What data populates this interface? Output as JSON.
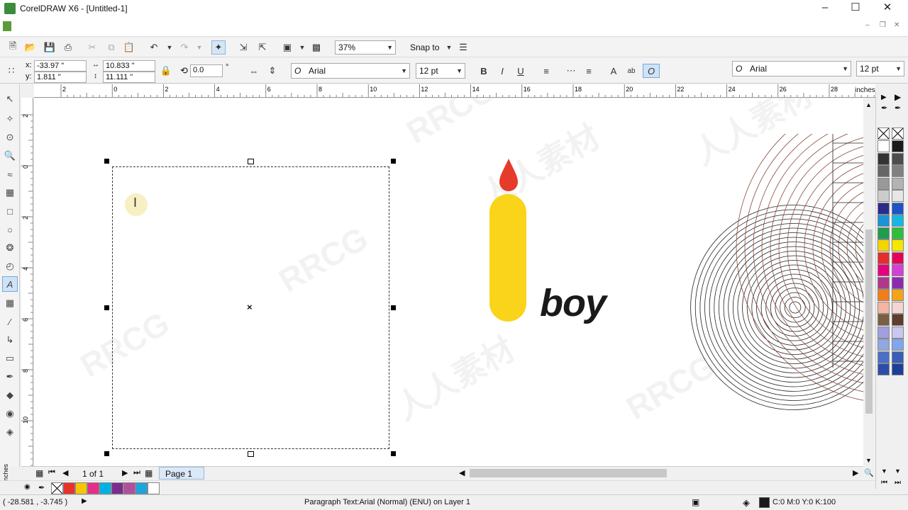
{
  "window": {
    "title": "CorelDRAW X6 - [Untitled-1]"
  },
  "toolbar1": {
    "zoom": "37%",
    "snap_label": "Snap to"
  },
  "propbar": {
    "x_label": "x:",
    "x_value": "-33.97 \"",
    "y_label": "y:",
    "y_value": "1.811 \"",
    "w_value": "10.833 \"",
    "h_value": "11.111 \"",
    "rotation": "0.0",
    "degree": "°",
    "font": "Arial",
    "size": "12 pt",
    "font2": "Arial",
    "size2": "12 pt"
  },
  "rulers": {
    "unit": "inches",
    "h_ticks": [
      "2",
      "0",
      "2",
      "4",
      "6",
      "8",
      "10",
      "12",
      "14",
      "16",
      "18",
      "20",
      "22",
      "24",
      "26",
      "28"
    ],
    "v_ticks": [
      "2",
      "0",
      "2",
      "4",
      "6",
      "8",
      "10"
    ]
  },
  "canvas": {
    "logo_text": "boy"
  },
  "pagebar": {
    "page_count": "1 of 1",
    "page_tab": "Page 1",
    "unit": "inches"
  },
  "statusbar": {
    "coords": "( -28.581 , -3.745 )",
    "info": "Paragraph Text:Arial (Normal) (ENU) on Layer 1",
    "color": "C:0 M:0 Y:0 K:100"
  },
  "watermark": {
    "text1": "RRCG",
    "text2": "人人素材"
  },
  "colors": {
    "doc_palette": [
      "#e8322b",
      "#f7c600",
      "#e62d8a",
      "#00b2e3",
      "#7b2d8f",
      "#b24f9c",
      "#1fa3dd",
      "#ffffff"
    ],
    "palette": [
      "#ffffff",
      "#1a1a1a",
      "#333333",
      "#4d4d4d",
      "#666666",
      "#808080",
      "#999999",
      "#b3b3b3",
      "#cccccc",
      "#e6e6e6",
      "#2b2b8c",
      "#1d53c8",
      "#1a94d6",
      "#16b8e3",
      "#1e9c4f",
      "#2dbf3a",
      "#f5d400",
      "#f4e800",
      "#e52d2d",
      "#e5005a",
      "#e6007e",
      "#d63fd6",
      "#b0388c",
      "#8c2bb0",
      "#f07e1a",
      "#f5a31a",
      "#f7b4a0",
      "#f2d6cf",
      "#7a6040",
      "#5c3d2e",
      "#a29ee0",
      "#c9c7f0",
      "#8fa8e0",
      "#7fa6ef",
      "#4a70c8",
      "#3a5fb8",
      "#2b4ea8",
      "#1c3f98"
    ]
  }
}
